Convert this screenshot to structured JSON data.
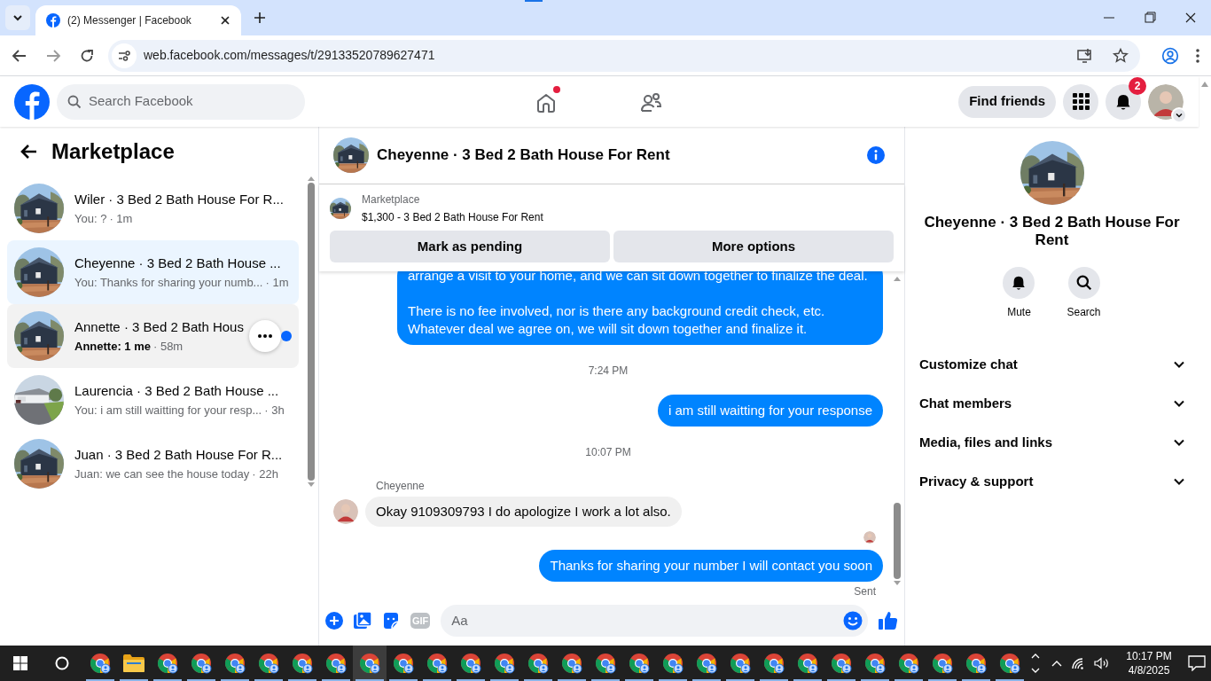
{
  "browser": {
    "tab_title": "(2) Messenger | Facebook",
    "url": "web.facebook.com/messages/t/29133520789627471"
  },
  "header": {
    "search_placeholder": "Search Facebook",
    "home_has_notification": true,
    "find_friends": "Find friends",
    "notification_count": "2"
  },
  "sidebar": {
    "title": "Marketplace",
    "conversations": [
      {
        "name": "Wiler · 3 Bed 2 Bath House For R...",
        "preview": "You: ?",
        "time": "· 1m",
        "selected": false,
        "unread": false,
        "hovered": false
      },
      {
        "name": "Cheyenne · 3 Bed 2 Bath House ...",
        "preview": "You: Thanks for sharing your numb...",
        "time": "· 1m",
        "selected": true,
        "unread": false,
        "hovered": false
      },
      {
        "name": "Annette · 3 Bed 2 Bath Hous",
        "preview": "Annette: 1 me",
        "time": "· 58m",
        "selected": false,
        "unread": true,
        "hovered": true
      },
      {
        "name": "Laurencia · 3 Bed 2 Bath House ...",
        "preview": "You: i am still waitting for your resp...",
        "time": "· 3h",
        "selected": false,
        "unread": false,
        "hovered": false
      },
      {
        "name": "Juan · 3 Bed 2 Bath House For R...",
        "preview": "Juan: we can see the house today",
        "time": "· 22h",
        "selected": false,
        "unread": false,
        "hovered": false
      }
    ]
  },
  "chat": {
    "title": "Cheyenne · 3 Bed 2 Bath House For Rent",
    "listing": {
      "source": "Marketplace",
      "summary": "$1,300 - 3 Bed 2 Bath House For Rent",
      "buttons": [
        "Mark as pending",
        "More options"
      ]
    },
    "messages": [
      {
        "kind": "outgoing",
        "paragraphs": [
          "arrange a visit to your home, and we can sit down together to finalize the deal.",
          "There is no fee involved, nor is there any background credit check, etc. Whatever deal we agree on, we will sit down together and finalize it."
        ]
      },
      {
        "kind": "time",
        "text": "7:24 PM"
      },
      {
        "kind": "outgoing",
        "paragraphs": [
          "i am still waitting for your response"
        ]
      },
      {
        "kind": "time",
        "text": "10:07 PM"
      },
      {
        "kind": "incoming",
        "sender": "Cheyenne",
        "paragraphs": [
          "Okay 9109309793 I do apologize I work a lot also."
        ]
      },
      {
        "kind": "seen"
      },
      {
        "kind": "outgoing",
        "paragraphs": [
          "Thanks for sharing your number I will contact you soon"
        ],
        "status": "Sent"
      }
    ],
    "composer": {
      "gif_label": "GIF",
      "placeholder": "Aa"
    }
  },
  "details": {
    "title": "Cheyenne · 3 Bed 2 Bath House For Rent",
    "actions": [
      {
        "kind": "bell",
        "label": "Mute"
      },
      {
        "kind": "search",
        "label": "Search"
      }
    ],
    "sections": [
      {
        "label": "Customize chat",
        "expanded": false
      },
      {
        "label": "Chat members",
        "expanded": false
      },
      {
        "label": "Media, files and links",
        "expanded": false
      },
      {
        "label": "Privacy & support",
        "expanded": false
      }
    ]
  },
  "taskbar": {
    "windows": [
      {
        "selected": false
      },
      {
        "selected": false
      },
      {
        "selected": false
      },
      {
        "selected": false
      },
      {
        "selected": false
      },
      {
        "selected": false
      },
      {
        "selected": true
      },
      {
        "selected": false
      },
      {
        "selected": false
      },
      {
        "selected": false
      },
      {
        "selected": false
      },
      {
        "selected": false
      },
      {
        "selected": false
      },
      {
        "selected": false
      },
      {
        "selected": false
      },
      {
        "selected": false
      },
      {
        "selected": false
      },
      {
        "selected": false
      },
      {
        "selected": false
      },
      {
        "selected": false
      },
      {
        "selected": false
      },
      {
        "selected": false
      },
      {
        "selected": false
      },
      {
        "selected": false
      },
      {
        "selected": false
      },
      {
        "selected": false
      }
    ],
    "time": "10:17 PM",
    "date": "4/8/2025"
  }
}
